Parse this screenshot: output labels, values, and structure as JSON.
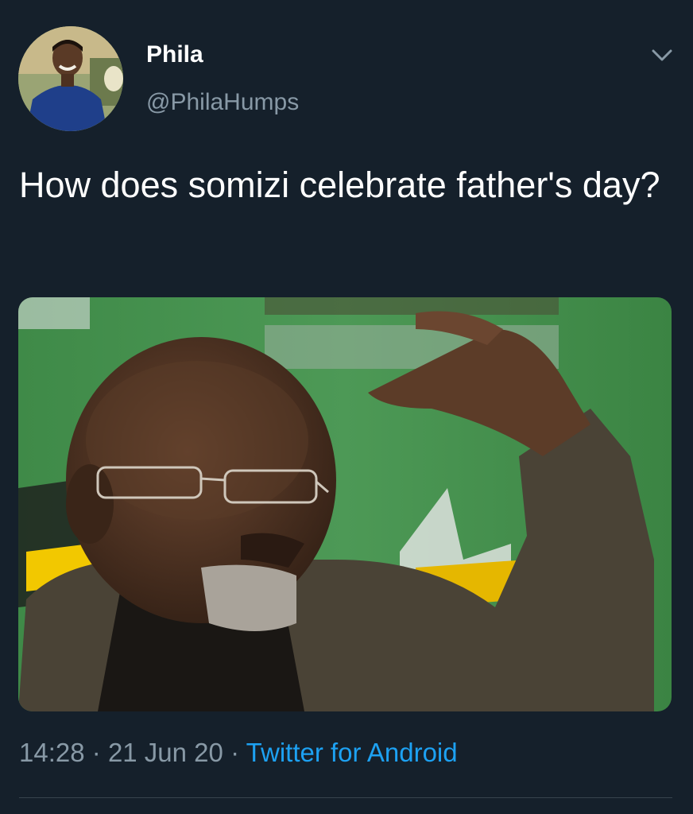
{
  "tweet": {
    "author_name": "Phila",
    "author_handle": "@PhilaHumps",
    "text": "How does somizi celebrate father's day?",
    "time": "14:28",
    "separator": "·",
    "date": "21 Jun 20",
    "source": "Twitter for Android"
  },
  "colors": {
    "background": "#15202b",
    "secondary_text": "#8899a6",
    "link": "#1da1f2"
  },
  "icons": {
    "menu": "chevron-down-icon"
  }
}
